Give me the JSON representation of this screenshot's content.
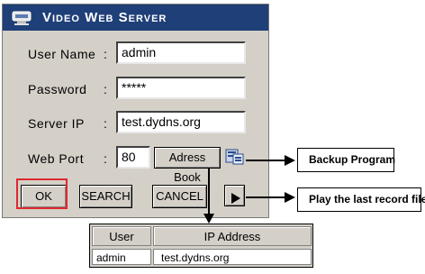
{
  "window": {
    "title": "Video Web Server"
  },
  "form": {
    "user_name_label": "User Name",
    "user_name_value": "admin",
    "password_label": "Password",
    "password_value": "*****",
    "server_ip_label": "Server IP",
    "server_ip_value": "test.dydns.org",
    "web_port_label": "Web Port",
    "web_port_value": "80",
    "colon": ":"
  },
  "buttons": {
    "address_book": "Adress Book",
    "ok": "OK",
    "search": "SEARCH",
    "cancel": "CANCEL"
  },
  "callouts": {
    "backup": "Backup Program",
    "play": "Play the last record file"
  },
  "address_table": {
    "headers": [
      "User",
      "IP Address"
    ],
    "rows": [
      {
        "user": "admin",
        "ip": "test.dydns.org"
      }
    ]
  },
  "colors": {
    "titlebar": "#1f3f78",
    "focus_highlight": "#e0272f",
    "window_face": "#d4d0c8"
  }
}
